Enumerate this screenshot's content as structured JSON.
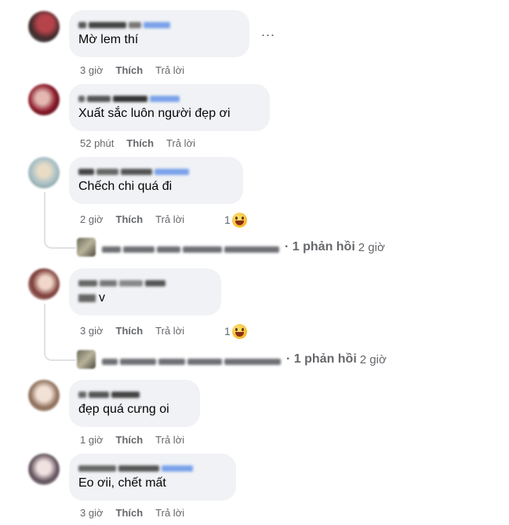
{
  "comments": [
    {
      "text": "Mờ lem thí",
      "time": "3 giờ",
      "like": "Thích",
      "reply": "Trả lời"
    },
    {
      "text": "Xuất sắc luôn người đẹp ơi",
      "time": "52 phút",
      "like": "Thích",
      "reply": "Trả lời"
    },
    {
      "text": "Chếch chi quá đi",
      "time": "2 giờ",
      "like": "Thích",
      "reply": "Trả lời",
      "reaction_count": "1",
      "reaction_icon": "haha-emoji-icon",
      "replies": {
        "summary": "· 1 phản hồi",
        "time": "2 giờ"
      }
    },
    {
      "text": "v",
      "time": "3 giờ",
      "like": "Thích",
      "reply": "Trả lời",
      "reaction_count": "1",
      "reaction_icon": "haha-emoji-icon",
      "replies": {
        "summary": "· 1 phản hồi",
        "time": "2 giờ"
      }
    },
    {
      "text": "đẹp quá cưng oi",
      "time": "1 giờ",
      "like": "Thích",
      "reply": "Trả lời"
    },
    {
      "text": "Eo ơii, chết mất",
      "time": "3 giờ",
      "like": "Thích",
      "reply": "Trả lời"
    }
  ],
  "more_menu": "...",
  "colors": {
    "bubble": "#f0f2f5",
    "meta": "#65676b",
    "name_link": "#1877f2"
  }
}
